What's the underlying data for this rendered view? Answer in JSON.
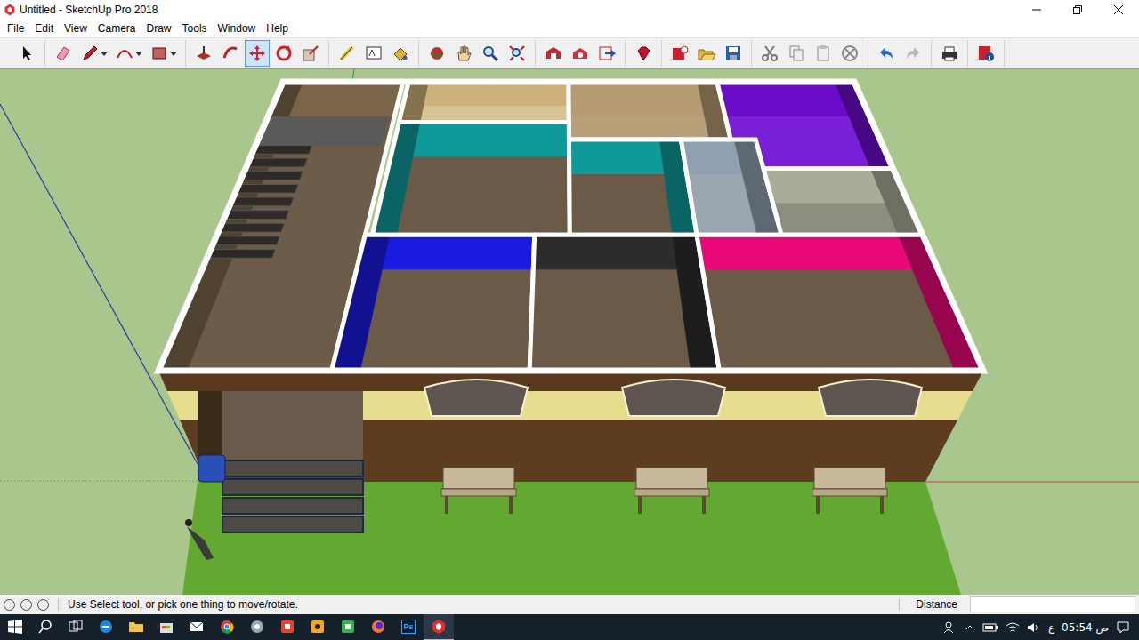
{
  "window": {
    "title": "Untitled - SketchUp Pro 2018"
  },
  "menu": [
    "File",
    "Edit",
    "View",
    "Camera",
    "Draw",
    "Tools",
    "Window",
    "Help"
  ],
  "toolbar": {
    "groups": [
      [
        {
          "kind": "select",
          "selected": false,
          "dropdown": false
        }
      ],
      [
        {
          "kind": "eraser",
          "selected": false,
          "dropdown": false
        },
        {
          "kind": "pencil",
          "selected": false,
          "dropdown": true
        },
        {
          "kind": "arc",
          "selected": false,
          "dropdown": true
        },
        {
          "kind": "rectangle",
          "selected": false,
          "dropdown": true
        }
      ],
      [
        {
          "kind": "pushpull",
          "selected": false,
          "dropdown": false
        },
        {
          "kind": "followme",
          "selected": false,
          "dropdown": false
        },
        {
          "kind": "move",
          "selected": true,
          "dropdown": false
        },
        {
          "kind": "rotate",
          "selected": false,
          "dropdown": false
        },
        {
          "kind": "scale",
          "selected": false,
          "dropdown": false
        }
      ],
      [
        {
          "kind": "tape",
          "selected": false,
          "dropdown": false
        },
        {
          "kind": "text",
          "selected": false,
          "dropdown": false
        },
        {
          "kind": "paint",
          "selected": false,
          "dropdown": false
        }
      ],
      [
        {
          "kind": "orbit",
          "selected": false,
          "dropdown": false
        },
        {
          "kind": "pan",
          "selected": false,
          "dropdown": false
        },
        {
          "kind": "zoom",
          "selected": false,
          "dropdown": false
        },
        {
          "kind": "zoomextents",
          "selected": false,
          "dropdown": false
        }
      ],
      [
        {
          "kind": "warehouse",
          "selected": false,
          "dropdown": false
        },
        {
          "kind": "extensions",
          "selected": false,
          "dropdown": false
        },
        {
          "kind": "share",
          "selected": false,
          "dropdown": false
        }
      ],
      [
        {
          "kind": "ruby",
          "selected": false,
          "dropdown": false
        }
      ],
      [
        {
          "kind": "addlocation",
          "selected": false,
          "dropdown": false
        },
        {
          "kind": "open",
          "selected": false,
          "dropdown": false
        },
        {
          "kind": "save",
          "selected": false,
          "dropdown": false
        }
      ],
      [
        {
          "kind": "cut",
          "selected": false,
          "dropdown": false
        },
        {
          "kind": "copy",
          "selected": false,
          "dropdown": false
        },
        {
          "kind": "paste",
          "selected": false,
          "dropdown": false
        },
        {
          "kind": "erase",
          "selected": false,
          "dropdown": false
        }
      ],
      [
        {
          "kind": "undo",
          "selected": false,
          "dropdown": false
        },
        {
          "kind": "redo",
          "selected": false,
          "dropdown": false
        }
      ],
      [
        {
          "kind": "print",
          "selected": false,
          "dropdown": false
        }
      ],
      [
        {
          "kind": "info",
          "selected": false,
          "dropdown": false
        }
      ]
    ]
  },
  "status_bar": {
    "hint": "Use Select tool, or pick one thing to move/rotate.",
    "measure_label": "Distance",
    "measure_value": ""
  },
  "taskbar": {
    "apps": [
      {
        "kind": "start",
        "label": "",
        "active": false
      },
      {
        "kind": "search",
        "label": "",
        "active": false
      },
      {
        "kind": "taskview",
        "label": "",
        "active": false
      },
      {
        "kind": "edge",
        "label": "",
        "active": false
      },
      {
        "kind": "explorer",
        "label": "",
        "active": false
      },
      {
        "kind": "store",
        "label": "",
        "active": false
      },
      {
        "kind": "mail",
        "label": "",
        "active": false
      },
      {
        "kind": "chrome",
        "label": "",
        "active": false
      },
      {
        "kind": "app",
        "label": "",
        "active": false
      },
      {
        "kind": "redapp",
        "label": "",
        "active": false
      },
      {
        "kind": "orangeapp",
        "label": "",
        "active": false
      },
      {
        "kind": "camtasia",
        "label": "",
        "active": false
      },
      {
        "kind": "firefox",
        "label": "",
        "active": false
      },
      {
        "kind": "photoshop",
        "label": "Ps",
        "active": false
      },
      {
        "kind": "sketchup",
        "label": "",
        "active": true
      }
    ],
    "language": "ع",
    "clock": "05:54 ص"
  }
}
